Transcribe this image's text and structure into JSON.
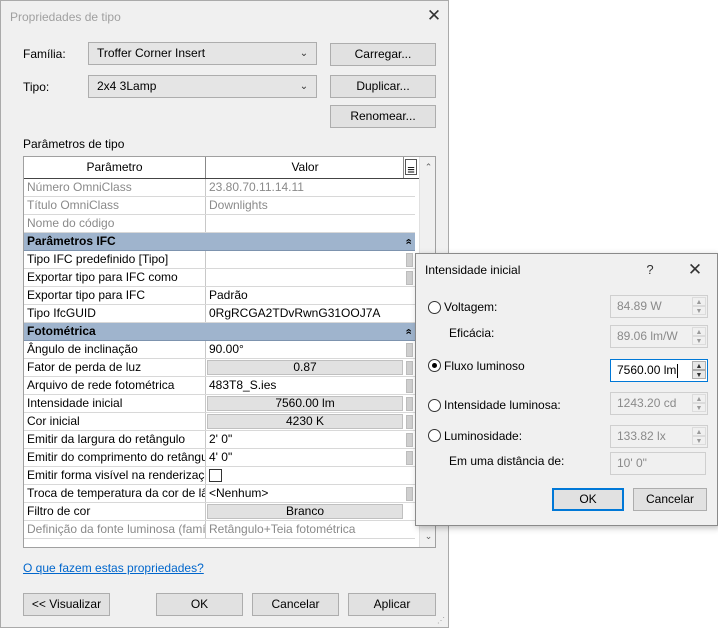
{
  "main_dialog": {
    "title": "Propriedades de tipo",
    "family_label": "Família:",
    "family_value": "Troffer Corner Insert",
    "type_label": "Tipo:",
    "type_value": "2x4 3Lamp",
    "load_button": "Carregar...",
    "duplicate_button": "Duplicar...",
    "rename_button": "Renomear...",
    "section_label": "Parâmetros de tipo",
    "grid_header": {
      "param": "Parâmetro",
      "value": "Valor",
      "menu_icon": "menu-icon"
    },
    "rows_top": [
      {
        "param": "Número OmniClass",
        "value": "23.80.70.11.14.11"
      },
      {
        "param": "Título OmniClass",
        "value": "Downlights"
      },
      {
        "param": "Nome do código",
        "value": ""
      }
    ],
    "group_ifc": "Parâmetros IFC",
    "rows_ifc": [
      {
        "param": "Tipo IFC predefinido [Tipo]",
        "value": ""
      },
      {
        "param": "Exportar tipo para IFC como",
        "value": ""
      },
      {
        "param": "Exportar tipo para IFC",
        "value": "Padrão"
      },
      {
        "param": "Tipo IfcGUID",
        "value": "0RgRCGA2TDvRwnG31OOJ7A"
      }
    ],
    "group_photometric": "Fotométrica",
    "rows_photo": [
      {
        "param": "Ângulo de inclinação",
        "value": "90.00°"
      },
      {
        "param": "Fator de perda de luz",
        "value": "0.87"
      },
      {
        "param": "Arquivo de rede fotométrica",
        "value": "483T8_S.ies"
      },
      {
        "param": "Intensidade inicial",
        "value": "7560.00 lm"
      },
      {
        "param": "Cor inicial",
        "value": "4230 K"
      },
      {
        "param": "Emitir da largura do retângulo",
        "value": "2'  0\""
      },
      {
        "param": "Emitir do comprimento do retângulo",
        "value": "4'  0\""
      },
      {
        "param": "Emitir forma visível na renderização",
        "value": ""
      },
      {
        "param": "Troca de temperatura da cor de lâmpada",
        "value": "<Nenhum>"
      },
      {
        "param": "Filtro de cor",
        "value": "Branco"
      },
      {
        "param": "Definição da fonte luminosa (família)",
        "value": "Retângulo+Teia fotométrica"
      }
    ],
    "help_link": "O que fazem estas propriedades?",
    "preview_button": "<< Visualizar",
    "ok_button": "OK",
    "cancel_button": "Cancelar",
    "apply_button": "Aplicar"
  },
  "sub_dialog": {
    "title": "Intensidade inicial",
    "help_icon": "?",
    "options": [
      {
        "label": "Voltagem:",
        "value": "84.89 W",
        "selected": false
      },
      {
        "label": "Fluxo luminoso",
        "value": "7560.00 lm",
        "selected": true
      },
      {
        "label": "Intensidade luminosa:",
        "value": "1243.20 cd",
        "selected": false
      },
      {
        "label": "Luminosidade:",
        "value": "133.82 lx",
        "selected": false
      }
    ],
    "efficacy_label": "Eficácia:",
    "efficacy_value": "89.06 lm/W",
    "distance_label": "Em uma distância de:",
    "distance_value": "10'  0\"",
    "ok_button": "OK",
    "cancel_button": "Cancelar"
  }
}
